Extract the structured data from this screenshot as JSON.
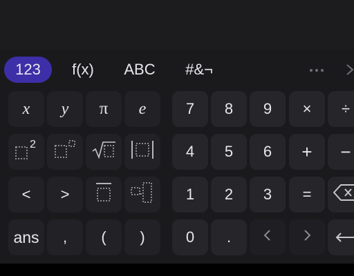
{
  "tabs": [
    {
      "label": "123",
      "active": true
    },
    {
      "label": "f(x)",
      "active": false
    },
    {
      "label": "ABC",
      "active": false
    },
    {
      "label": "#&¬",
      "active": false
    }
  ],
  "keys": {
    "row1": [
      "x",
      "y",
      "π",
      "e",
      "7",
      "8",
      "9",
      "×",
      "÷"
    ],
    "row2": [
      "",
      "",
      "",
      "",
      "4",
      "5",
      "6",
      "+",
      "−"
    ],
    "row2_icons": [
      "squared-icon",
      "power-icon",
      "square-root-icon",
      "absolute-value-icon"
    ],
    "row2_superscript": "2",
    "row3": [
      "<",
      ">",
      "",
      "",
      "1",
      "2",
      "3",
      "="
    ],
    "row3_icons": [
      "overline-icon",
      "subscript-icon",
      "backspace-icon"
    ],
    "row4": [
      "ans",
      ",",
      "(",
      ")",
      "0",
      "."
    ],
    "row4_icons": [
      "cursor-left-icon",
      "cursor-right-icon",
      "enter-icon"
    ]
  },
  "icons": {
    "more": "more-horizontal-icon",
    "collapse": "chevron-right-icon"
  },
  "colors": {
    "active_tab": "#3d2fa8",
    "keyboard_bg": "#1a1a1d",
    "function_key": "#222226",
    "number_key": "#26262a",
    "text": "#e8e8ec",
    "placeholder": "#8a8a92"
  }
}
